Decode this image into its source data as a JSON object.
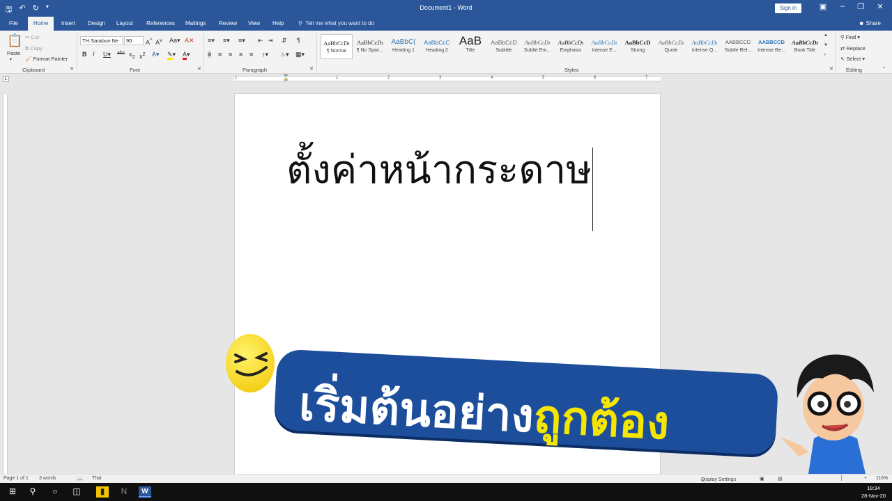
{
  "titlebar": {
    "title": "Document1  -  Word",
    "sign_in": "Sign in",
    "save_icon": "save-icon",
    "undo_icon": "undo-icon",
    "redo_icon": "redo-icon"
  },
  "tabs": [
    "File",
    "Home",
    "Insert",
    "Design",
    "Layout",
    "References",
    "Mailings",
    "Review",
    "View",
    "Help"
  ],
  "tell_me": "Tell me what you want to do",
  "share": "Share",
  "clipboard": {
    "paste": "Paste",
    "cut": "Cut",
    "copy": "Copy",
    "format_painter": "Format Painter",
    "label": "Clipboard"
  },
  "font": {
    "name": "TH Sarabun Ne",
    "size": "90",
    "label": "Font"
  },
  "paragraph": {
    "label": "Paragraph"
  },
  "styles": {
    "label": "Styles",
    "items": [
      {
        "preview": "AaBbCcDı",
        "name": "¶ Normal"
      },
      {
        "preview": "AaBbCcDı",
        "name": "¶ No Spac..."
      },
      {
        "preview": "AaBbC(",
        "name": "Heading 1"
      },
      {
        "preview": "AaBbCcC",
        "name": "Heading 2"
      },
      {
        "preview": "AaB",
        "name": "Title"
      },
      {
        "preview": "AaBbCcD",
        "name": "Subtitle"
      },
      {
        "preview": "AaBbCcDı",
        "name": "Subtle Em..."
      },
      {
        "preview": "AaBbCcDı",
        "name": "Emphasis"
      },
      {
        "preview": "AaBbCcDı",
        "name": "Intense E..."
      },
      {
        "preview": "AaBbCcD",
        "name": "Strong"
      },
      {
        "preview": "AaBbCcDı",
        "name": "Quote"
      },
      {
        "preview": "AaBbCcDı",
        "name": "Intense Q..."
      },
      {
        "preview": "AABBCCD",
        "name": "Subtle Ref..."
      },
      {
        "preview": "AABBCCD",
        "name": "Intense Re..."
      },
      {
        "preview": "AaBbCcDı",
        "name": "Book Title"
      }
    ]
  },
  "editing": {
    "find": "Find",
    "replace": "Replace",
    "select": "Select",
    "label": "Editing"
  },
  "ruler_numbers": [
    "1",
    "1",
    "2",
    "3",
    "4",
    "5",
    "6",
    "7"
  ],
  "document": {
    "text": "ตั้งค่าหน้ากระดาษ"
  },
  "banner": {
    "part1": "เริ่มต้นอย่าง",
    "part2": "ถูกต้อง"
  },
  "status": {
    "page": "Page 1 of 1",
    "words": "3 words",
    "language": "Thai",
    "display_settings": "Display Settings",
    "zoom": "116%"
  },
  "clock": {
    "time": "18:34",
    "date": "28-Nov-20"
  },
  "colors": {
    "accent": "#2b579a",
    "banner_blue": "#1d4e9c",
    "banner_yellow": "#f5e600"
  }
}
